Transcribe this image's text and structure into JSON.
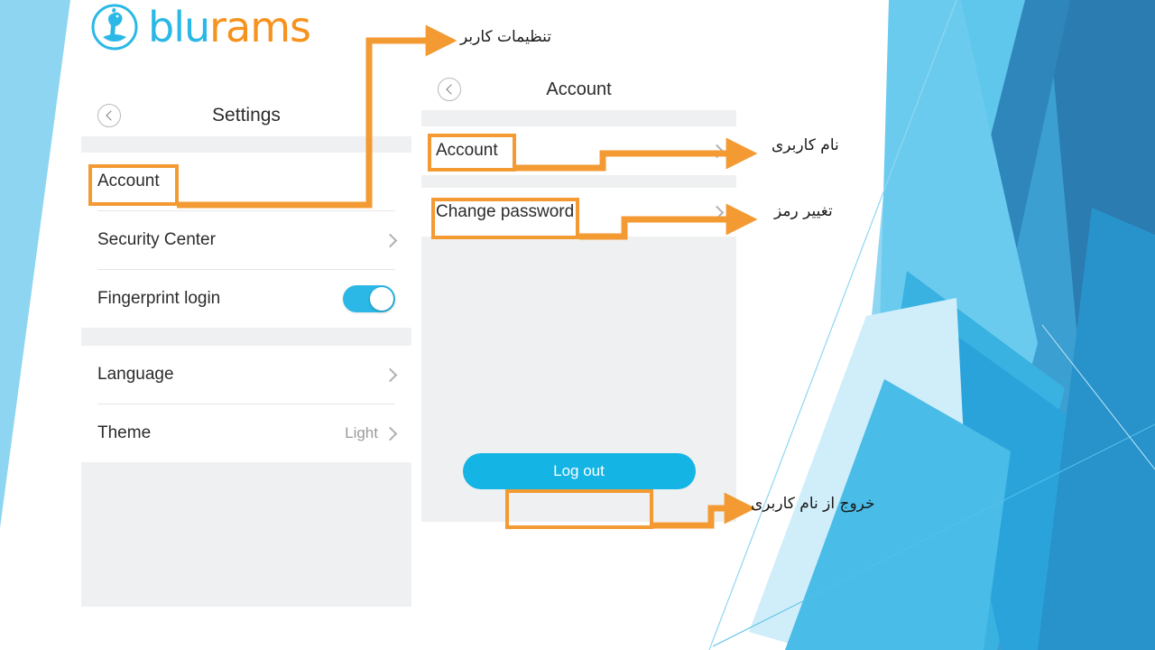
{
  "slide": {
    "brand": {
      "logo_blue_text": "blu",
      "logo_orange_text": "rams",
      "logo_icon": "blurams-ram-circle-icon"
    },
    "colors": {
      "brand_blue": "#2BB8E6",
      "brand_orange": "#F6921E",
      "highlight_orange": "#F39A33",
      "toggle_on": "#2BB8E6",
      "button_cyan": "#14B4E4",
      "panel_gray": "#EFF0F1",
      "bg_deep_blue": "#2B7CB0"
    }
  },
  "settings_screen": {
    "back_icon": "chevron-left-circle-icon",
    "title": "Settings",
    "items": [
      {
        "label": "Account",
        "value": "",
        "accessory": "none"
      },
      {
        "label": "Security Center",
        "value": "",
        "accessory": "chevron-right"
      },
      {
        "label": "Fingerprint login",
        "value": "",
        "accessory": "toggle-on"
      },
      {
        "label": "Language",
        "value": "",
        "accessory": "chevron-right"
      },
      {
        "label": "Theme",
        "value": "Light",
        "accessory": "chevron-right"
      }
    ]
  },
  "account_screen": {
    "back_icon": "chevron-left-circle-icon",
    "title": "Account",
    "items": [
      {
        "label": "Account",
        "accessory": "chevron-right"
      },
      {
        "label": "Change password",
        "accessory": "chevron-right"
      }
    ],
    "logout_label": "Log out"
  },
  "annotations": {
    "settings_callout": "تنظیمات کاربر",
    "username_callout": "نام کاربری",
    "change_password_callout": "تغییر رمز",
    "logout_callout": "خروج از نام کاربری"
  }
}
